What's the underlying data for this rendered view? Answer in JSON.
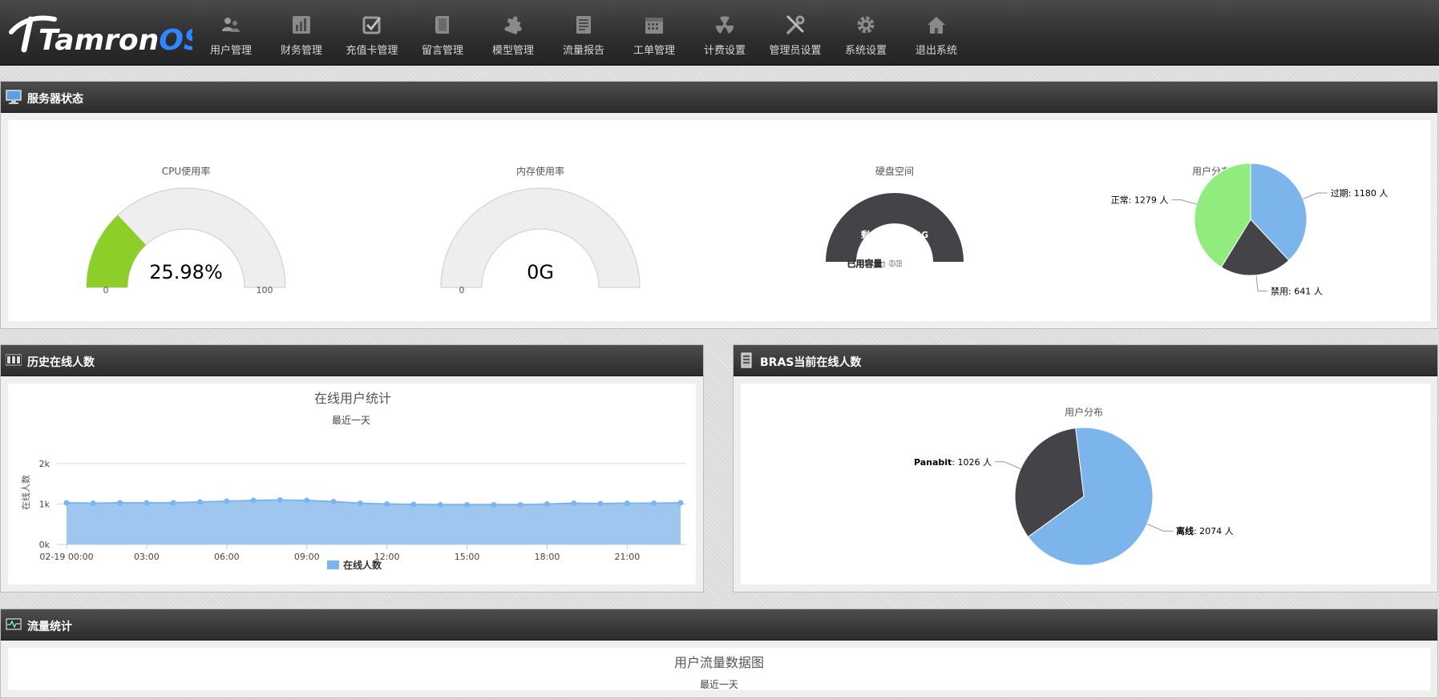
{
  "app": {
    "logo_text": "TamronOS",
    "logo_main": "Tamron",
    "logo_suffix": "OS"
  },
  "nav": [
    {
      "label": "用户管理",
      "icon": "users-icon"
    },
    {
      "label": "财务管理",
      "icon": "bar-chart-icon"
    },
    {
      "label": "充值卡管理",
      "icon": "checkbox-icon"
    },
    {
      "label": "留言管理",
      "icon": "book-icon"
    },
    {
      "label": "模型管理",
      "icon": "puzzle-icon"
    },
    {
      "label": "流量报告",
      "icon": "report-icon"
    },
    {
      "label": "工单管理",
      "icon": "calendar-icon"
    },
    {
      "label": "计费设置",
      "icon": "radiation-icon"
    },
    {
      "label": "管理员设置",
      "icon": "tools-icon"
    },
    {
      "label": "系统设置",
      "icon": "gear-icon"
    },
    {
      "label": "退出系统",
      "icon": "home-icon"
    }
  ],
  "server_status": {
    "title": "服务器状态",
    "cpu": {
      "title": "CPU使用率",
      "value": 25.98,
      "value_text": "25.98%",
      "min": "0",
      "max": "100"
    },
    "memory": {
      "title": "内存使用率",
      "value": 0,
      "value_text": "0G",
      "min": "0"
    },
    "disk": {
      "title": "硬盘空间",
      "remaining_label": "剩余容量: 100G",
      "used_label": "已用容量: 0G",
      "remaining": 100,
      "used": 0
    },
    "user_distribution": {
      "title": "用户分布",
      "slices": [
        {
          "label": "过期",
          "value": 1180,
          "display": "过期: 1180 人",
          "color": "#7cb5ec"
        },
        {
          "label": "禁用",
          "value": 641,
          "display": "禁用: 641 人",
          "color": "#434348"
        },
        {
          "label": "正常",
          "value": 1279,
          "display": "正常: 1279 人",
          "color": "#90ed7d"
        }
      ]
    }
  },
  "history": {
    "title": "历史在线人数"
  },
  "bras": {
    "title": "BRAS当前在线人数"
  },
  "traffic": {
    "title": "流量统计",
    "chart_title": "用户流量数据图",
    "chart_subtitle": "最近一天"
  },
  "chart_data": [
    {
      "type": "area",
      "title": "在线用户统计",
      "subtitle": "最近一天",
      "ylabel": "在线人数",
      "ylim": [
        0,
        2000
      ],
      "yticks": [
        "0k",
        "1k",
        "2k"
      ],
      "xticks": [
        "02-19 00:00",
        "03:00",
        "06:00",
        "09:00",
        "12:00",
        "15:00",
        "18:00",
        "21:00"
      ],
      "series": [
        {
          "name": "在线人数",
          "color": "#7cb5ec",
          "values": [
            1030,
            1020,
            1030,
            1030,
            1030,
            1050,
            1070,
            1090,
            1100,
            1090,
            1060,
            1020,
            1000,
            990,
            980,
            980,
            980,
            980,
            1000,
            1020,
            1010,
            1020,
            1020,
            1030
          ]
        }
      ],
      "legend": "bottom"
    },
    {
      "type": "pie",
      "title": "用户分布",
      "series": [
        {
          "name": "Panabit",
          "value": 1026,
          "display_name": "Panabit",
          "display_value": ": 1026 人",
          "color": "#434348"
        },
        {
          "name": "离线",
          "value": 2074,
          "display_name": "离线",
          "display_value": ": 2074 人",
          "color": "#7cb5ec"
        }
      ]
    }
  ]
}
